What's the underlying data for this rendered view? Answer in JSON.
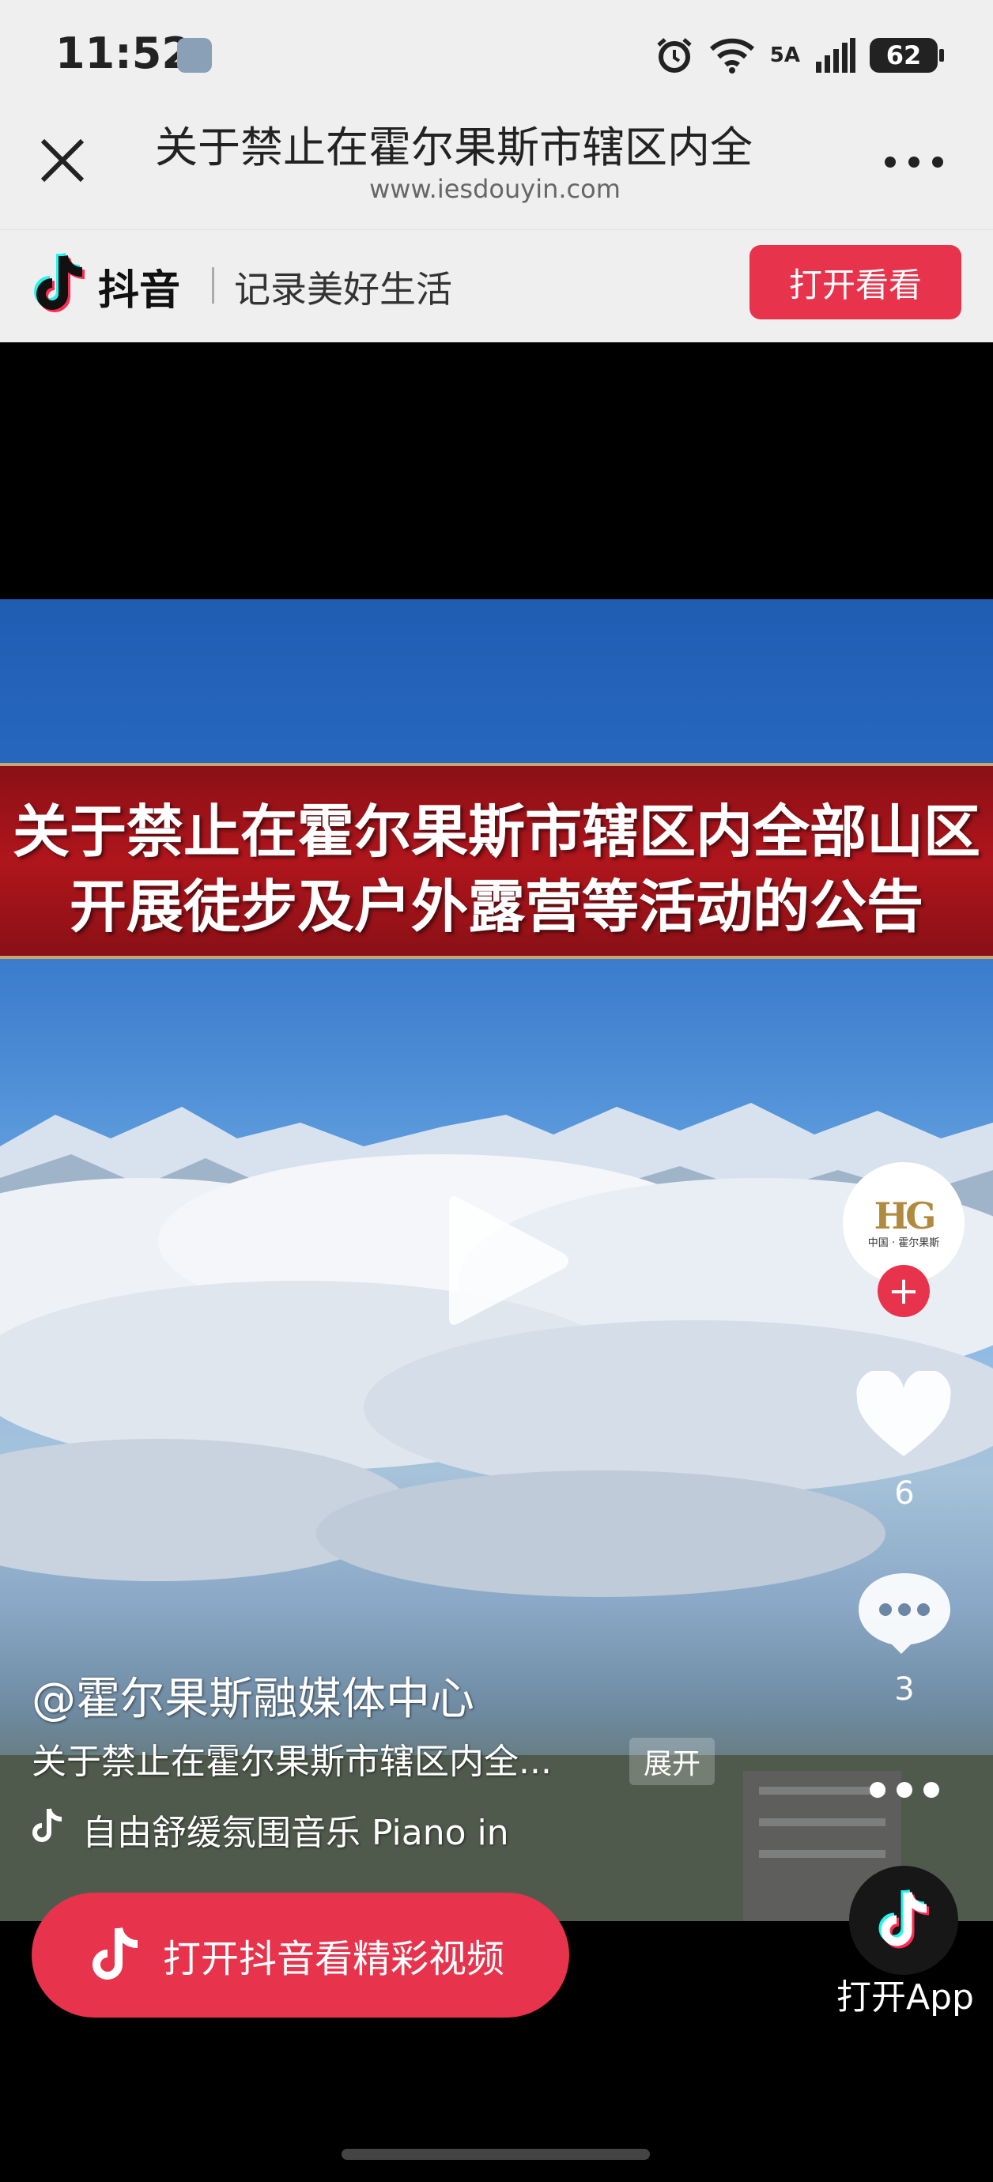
{
  "status_bar": {
    "time": "11:52",
    "network": "5A",
    "battery": "62"
  },
  "browser": {
    "title": "关于禁止在霍尔果斯市辖区内全",
    "url": "www.iesdouyin.com"
  },
  "douyin_bar": {
    "brand": "抖音",
    "slogan": "记录美好生活",
    "open_button": "打开看看"
  },
  "video": {
    "banner_line1": "关于禁止在霍尔果斯市辖区内全部山区",
    "banner_line2": "开展徒步及户外露营等活动的公告"
  },
  "actions": {
    "avatar_mark": "HG",
    "avatar_text": "中国 · 霍尔果斯",
    "follow": "+",
    "likes": "6",
    "comments": "3",
    "open_app": "打开App"
  },
  "caption": {
    "author": "@霍尔果斯融媒体中心",
    "text": "关于禁止在霍尔果斯市辖区内全...",
    "expand": "展开",
    "music": "自由舒缓氛围音乐 Piano in"
  },
  "open_pill": {
    "label": "打开抖音看精彩视频"
  },
  "colors": {
    "accent": "#e8334c",
    "banner_red": "#b0151c",
    "header_bg": "#efefef"
  }
}
